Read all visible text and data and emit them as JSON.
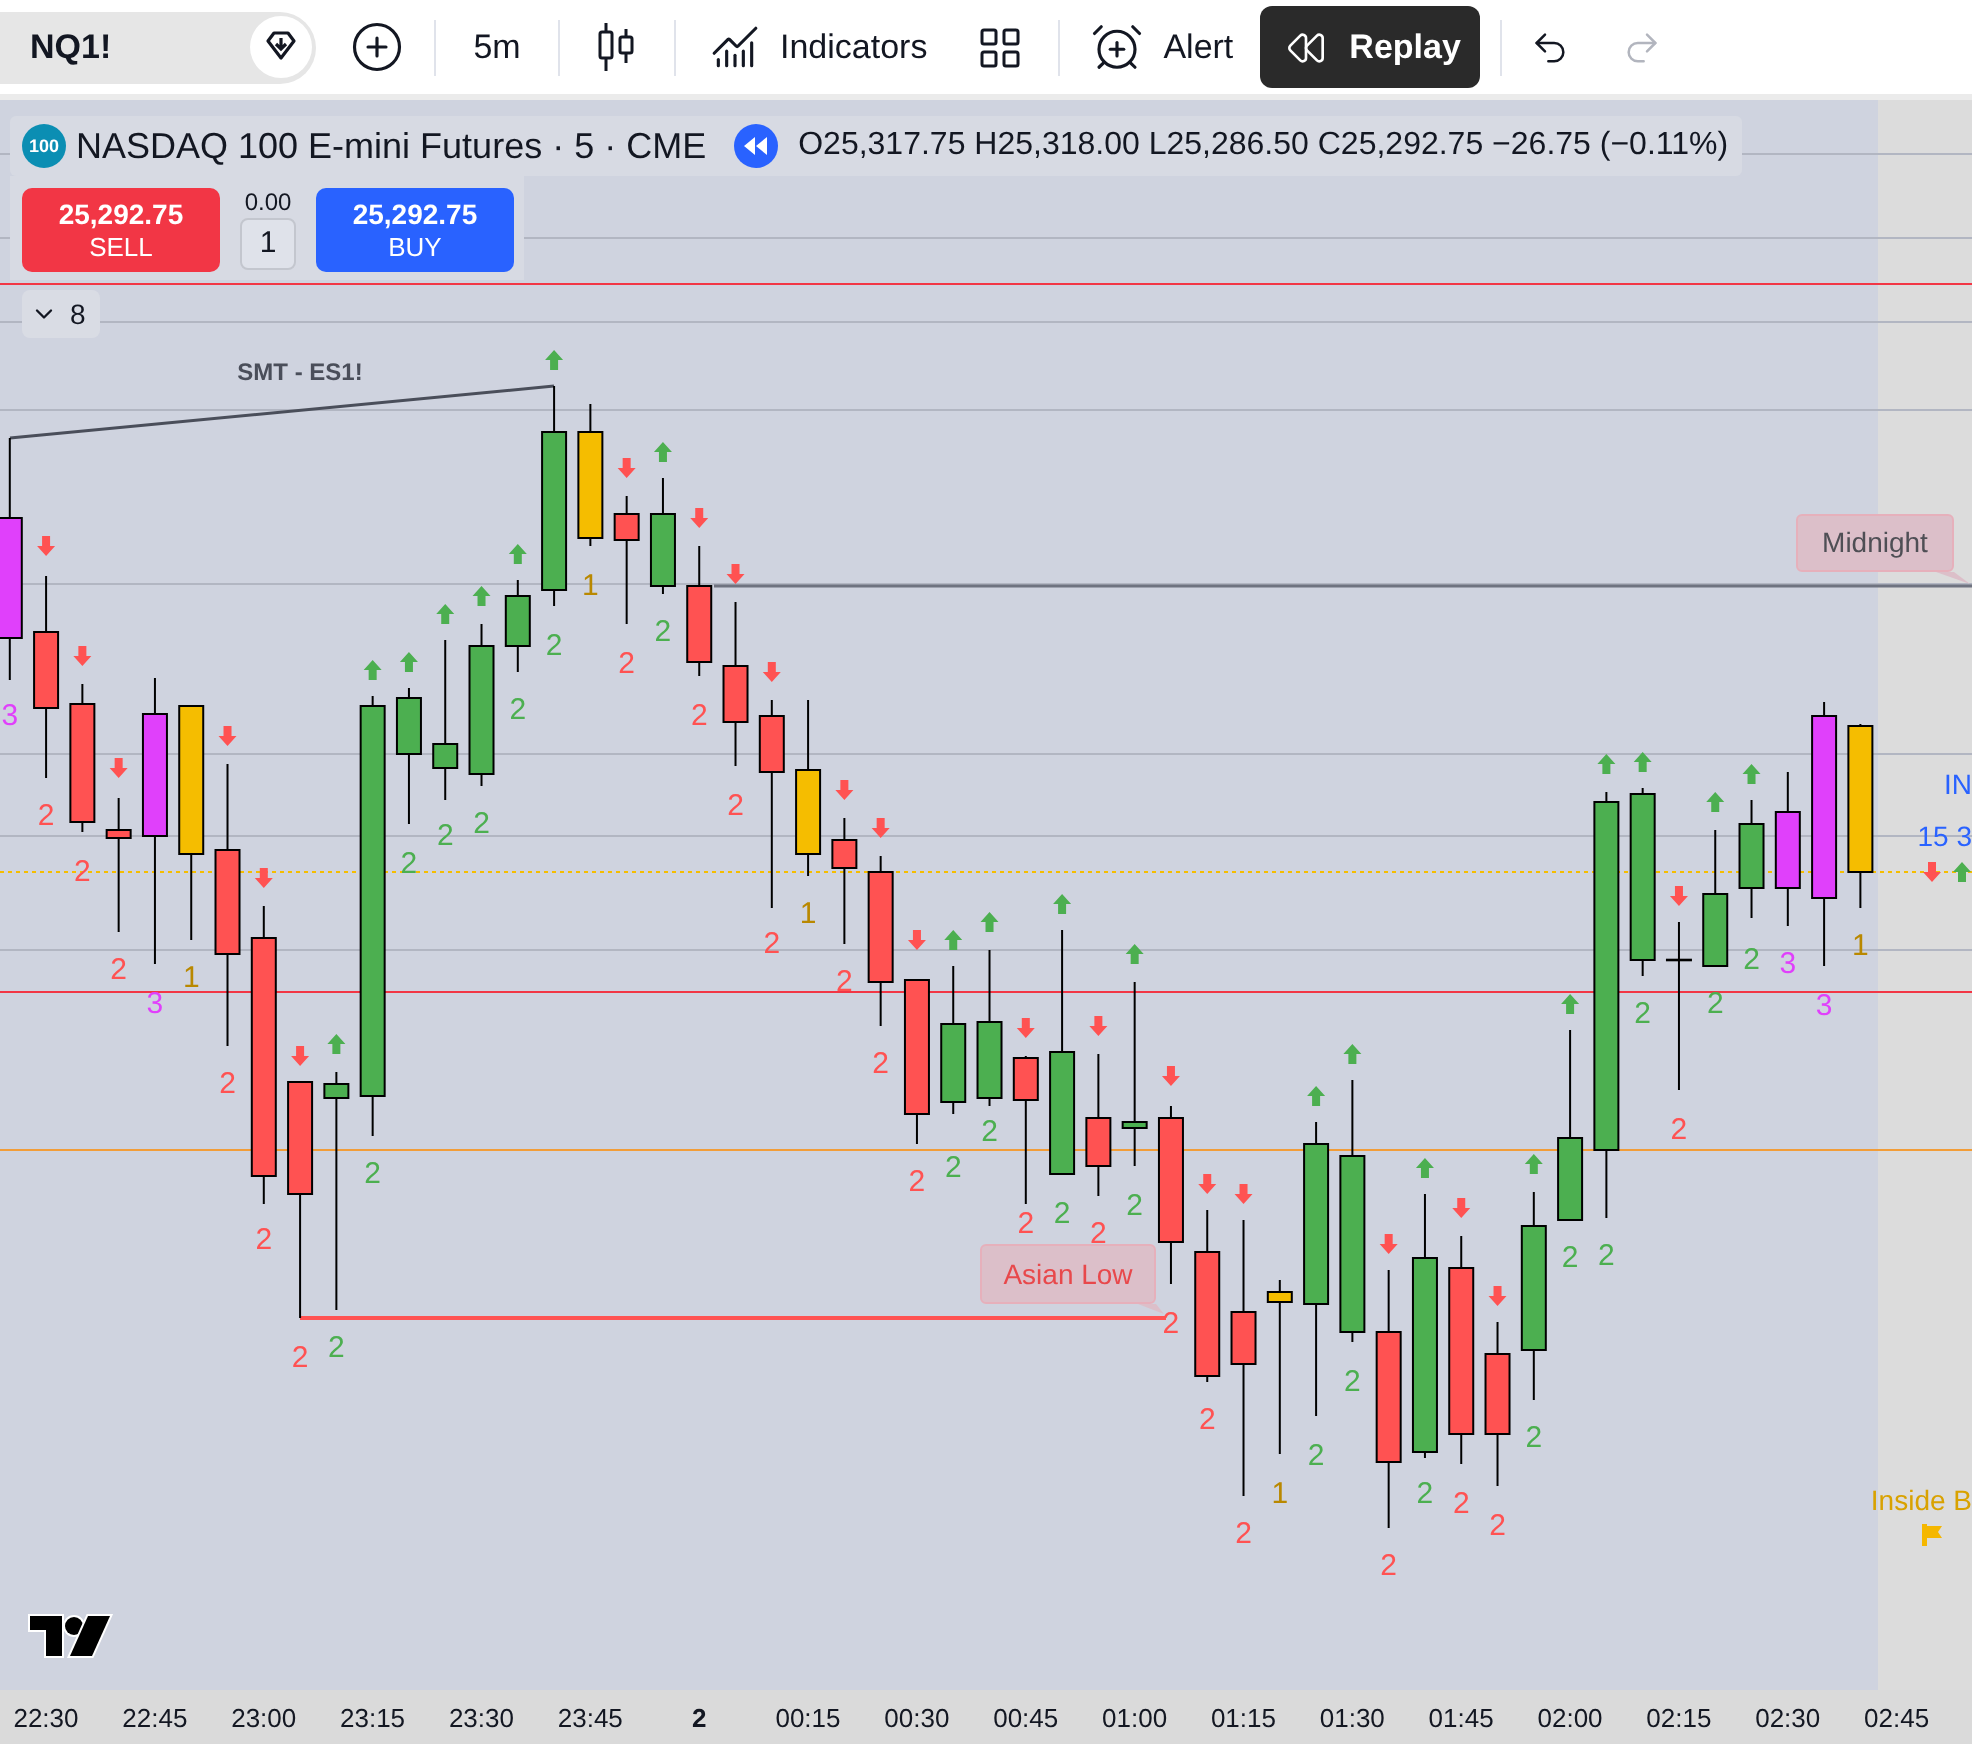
{
  "toolbar": {
    "symbol": "NQ1!",
    "interval": "5m",
    "indicators": "Indicators",
    "alert": "Alert",
    "replay": {
      "label": "Replay",
      "active": true
    },
    "undo": {
      "disabled": false
    },
    "redo": {
      "disabled": true
    }
  },
  "legend": {
    "badge": "100",
    "title": "NASDAQ 100 E-mini Futures · 5 · CME",
    "ohlc": "O25,317.75 H25,318.00 L25,286.50 C25,292.75 −26.75 (−0.11%)"
  },
  "trade": {
    "sell": {
      "price": "25,292.75",
      "label": "SELL"
    },
    "spread": "0.00",
    "quantity": "1",
    "buy": {
      "price": "25,292.75",
      "label": "BUY"
    }
  },
  "indicators_toggle": {
    "count": "8",
    "expanded": false
  },
  "chart": {
    "smt_label": "SMT - ES1!",
    "midnight_label": "Midnight",
    "asian_low_label": "Asian Low",
    "bar_labels": [
      {
        "text": "3",
        "color": "#e040fb"
      },
      {
        "text": "2",
        "color": "#ff5252"
      },
      {
        "text": "2",
        "color": "#ff5252"
      },
      {
        "text": "2",
        "color": "#ff5252"
      },
      {
        "text": "3",
        "color": "#e040fb"
      },
      {
        "text": "1",
        "color": "#b98800"
      },
      {
        "text": "2",
        "color": "#ff5252"
      },
      {
        "text": "2",
        "color": "#ff5252"
      },
      {
        "text": "2",
        "color": "#ff5252"
      },
      {
        "text": "2",
        "color": "#4caf50"
      },
      {
        "text": "2",
        "color": "#4caf50"
      },
      {
        "text": "2",
        "color": "#4caf50"
      },
      {
        "text": "2",
        "color": "#4caf50"
      },
      {
        "text": "2",
        "color": "#4caf50"
      },
      {
        "text": "2",
        "color": "#4caf50"
      },
      {
        "text": "2",
        "color": "#4caf50"
      },
      {
        "text": "1",
        "color": "#b98800"
      },
      {
        "text": "2",
        "color": "#ff5252"
      },
      {
        "text": "2",
        "color": "#4caf50"
      },
      {
        "text": "2",
        "color": "#ff5252"
      },
      {
        "text": "2",
        "color": "#ff5252"
      },
      {
        "text": "2",
        "color": "#ff5252"
      },
      {
        "text": "1",
        "color": "#b98800"
      },
      {
        "text": "2",
        "color": "#ff5252"
      },
      {
        "text": "2",
        "color": "#ff5252"
      },
      {
        "text": "2",
        "color": "#ff5252"
      },
      {
        "text": "2",
        "color": "#4caf50"
      },
      {
        "text": "2",
        "color": "#4caf50"
      },
      {
        "text": "2",
        "color": "#ff5252"
      },
      {
        "text": "2",
        "color": "#4caf50"
      },
      {
        "text": "2",
        "color": "#ff5252"
      },
      {
        "text": "2",
        "color": "#4caf50"
      },
      {
        "text": "2",
        "color": "#ff5252"
      },
      {
        "text": "2",
        "color": "#ff5252"
      },
      {
        "text": "2",
        "color": "#ff5252"
      },
      {
        "text": "1",
        "color": "#b98800"
      },
      {
        "text": "2",
        "color": "#4caf50"
      },
      {
        "text": "2",
        "color": "#4caf50"
      },
      {
        "text": "2",
        "color": "#ff5252"
      },
      {
        "text": "2",
        "color": "#4caf50"
      },
      {
        "text": "2",
        "color": "#ff5252"
      },
      {
        "text": "2",
        "color": "#ff5252"
      },
      {
        "text": "2",
        "color": "#4caf50"
      },
      {
        "text": "2",
        "color": "#4caf50"
      },
      {
        "text": "2",
        "color": "#4caf50"
      },
      {
        "text": "2",
        "color": "#4caf50"
      },
      {
        "text": "2",
        "color": "#ff5252"
      },
      {
        "text": "2",
        "color": "#4caf50"
      },
      {
        "text": "2",
        "color": "#4caf50"
      },
      {
        "text": "3",
        "color": "#e040fb"
      },
      {
        "text": "3",
        "color": "#e040fb"
      },
      {
        "text": "1",
        "color": "#b98800"
      }
    ],
    "edge_labels": [
      {
        "text": "IN",
        "color": "#2962ff"
      },
      {
        "text": "15 3",
        "color": "#2962ff"
      },
      {
        "text": "Inside B",
        "color": "#d9a200"
      }
    ]
  },
  "time_axis": [
    {
      "label": "22:30",
      "kind": "time"
    },
    {
      "label": "22:45",
      "kind": "time"
    },
    {
      "label": "23:00",
      "kind": "time"
    },
    {
      "label": "23:15",
      "kind": "time"
    },
    {
      "label": "23:30",
      "kind": "time"
    },
    {
      "label": "23:45",
      "kind": "time"
    },
    {
      "label": "2",
      "kind": "day"
    },
    {
      "label": "00:15",
      "kind": "time"
    },
    {
      "label": "00:30",
      "kind": "time"
    },
    {
      "label": "00:45",
      "kind": "time"
    },
    {
      "label": "01:00",
      "kind": "time"
    },
    {
      "label": "01:15",
      "kind": "time"
    },
    {
      "label": "01:30",
      "kind": "time"
    },
    {
      "label": "01:45",
      "kind": "time"
    },
    {
      "label": "02:00",
      "kind": "time"
    },
    {
      "label": "02:15",
      "kind": "time"
    },
    {
      "label": "02:30",
      "kind": "time"
    },
    {
      "label": "02:45",
      "kind": "time"
    }
  ]
}
